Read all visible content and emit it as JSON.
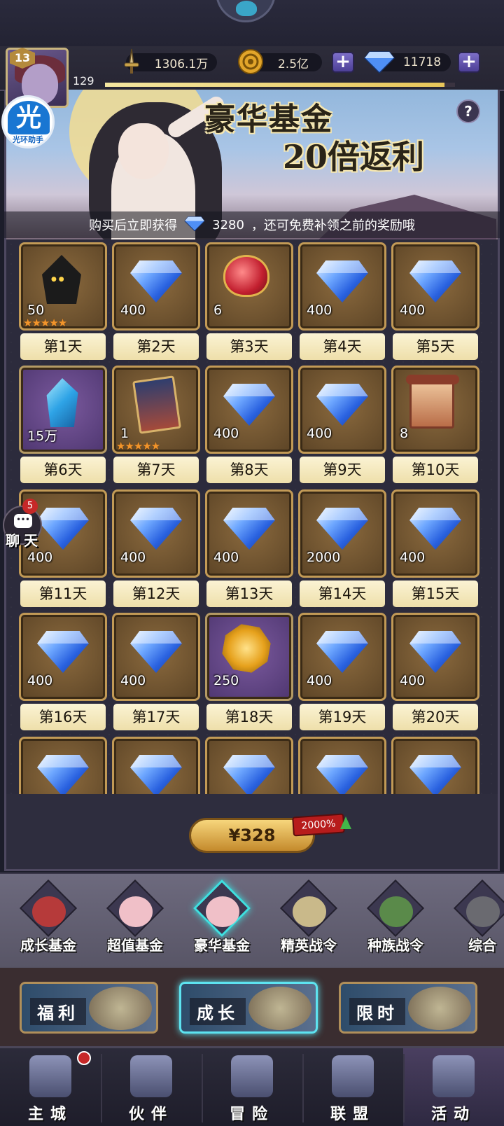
{
  "resources": {
    "power": "1306.1万",
    "gold": "2.5亿",
    "diamonds": "11718"
  },
  "player": {
    "level": "13",
    "exp_value": "129",
    "exp_progress": 0.97,
    "helper_glyph": "光",
    "helper_label": "光环助手"
  },
  "banner": {
    "title_line1": "豪华基金",
    "title_line2": "20倍返利",
    "help_glyph": "?",
    "note_prefix": "购买后立即获得",
    "note_amount": "3280",
    "note_suffix": "，还可免费补领之前的奖励哦"
  },
  "rewards": [
    {
      "day": "第1天",
      "qty": "50",
      "icon": "hooded-hero-icon",
      "stars": "★★★★★",
      "bg": "brown"
    },
    {
      "day": "第2天",
      "qty": "400",
      "icon": "diamond-icon",
      "stars": "",
      "bg": "brown"
    },
    {
      "day": "第3天",
      "qty": "6",
      "icon": "ruby-heart-icon",
      "stars": "",
      "bg": "brown"
    },
    {
      "day": "第4天",
      "qty": "400",
      "icon": "diamond-icon",
      "stars": "",
      "bg": "brown"
    },
    {
      "day": "第5天",
      "qty": "400",
      "icon": "diamond-icon",
      "stars": "",
      "bg": "brown"
    },
    {
      "day": "第6天",
      "qty": "15万",
      "icon": "crystal-icon",
      "stars": "",
      "bg": "purple"
    },
    {
      "day": "第7天",
      "qty": "1",
      "icon": "hero-card-icon",
      "stars": "★★★★★",
      "bg": "brown"
    },
    {
      "day": "第8天",
      "qty": "400",
      "icon": "diamond-icon",
      "stars": "",
      "bg": "brown"
    },
    {
      "day": "第9天",
      "qty": "400",
      "icon": "diamond-icon",
      "stars": "",
      "bg": "brown"
    },
    {
      "day": "第10天",
      "qty": "8",
      "icon": "scroll-icon",
      "stars": "",
      "bg": "brown"
    },
    {
      "day": "第11天",
      "qty": "400",
      "icon": "diamond-icon",
      "stars": "",
      "bg": "brown"
    },
    {
      "day": "第12天",
      "qty": "400",
      "icon": "diamond-icon",
      "stars": "",
      "bg": "brown"
    },
    {
      "day": "第13天",
      "qty": "400",
      "icon": "diamond-icon",
      "stars": "",
      "bg": "brown"
    },
    {
      "day": "第14天",
      "qty": "2000",
      "icon": "diamond-icon",
      "stars": "",
      "bg": "brown"
    },
    {
      "day": "第15天",
      "qty": "400",
      "icon": "diamond-icon",
      "stars": "",
      "bg": "brown"
    },
    {
      "day": "第16天",
      "qty": "400",
      "icon": "diamond-icon",
      "stars": "",
      "bg": "brown"
    },
    {
      "day": "第17天",
      "qty": "400",
      "icon": "diamond-icon",
      "stars": "",
      "bg": "brown"
    },
    {
      "day": "第18天",
      "qty": "250",
      "icon": "gold-token-icon",
      "stars": "",
      "bg": "purple"
    },
    {
      "day": "第19天",
      "qty": "400",
      "icon": "diamond-icon",
      "stars": "",
      "bg": "brown"
    },
    {
      "day": "第20天",
      "qty": "400",
      "icon": "diamond-icon",
      "stars": "",
      "bg": "brown"
    },
    {
      "day": "",
      "qty": "",
      "icon": "diamond-icon",
      "stars": "",
      "bg": "brown"
    },
    {
      "day": "",
      "qty": "",
      "icon": "diamond-icon",
      "stars": "",
      "bg": "brown"
    },
    {
      "day": "",
      "qty": "",
      "icon": "diamond-icon",
      "stars": "",
      "bg": "brown"
    },
    {
      "day": "",
      "qty": "",
      "icon": "diamond-icon",
      "stars": "",
      "bg": "brown"
    },
    {
      "day": "",
      "qty": "",
      "icon": "diamond-icon",
      "stars": "",
      "bg": "brown"
    }
  ],
  "chat": {
    "label": "聊天",
    "badge": "5"
  },
  "purchase": {
    "price": "¥328",
    "bonus": "2000%"
  },
  "fund_tabs": [
    {
      "label": "成长基金",
      "icon": "gift-chart-icon",
      "active": false
    },
    {
      "label": "超值基金",
      "icon": "piggy-bank-icon",
      "active": false
    },
    {
      "label": "豪华基金",
      "icon": "piggy-diamond-icon",
      "active": true
    },
    {
      "label": "精英战令",
      "icon": "scroll-badge-icon",
      "active": false
    },
    {
      "label": "种族战令",
      "icon": "vine-badge-icon",
      "active": false
    },
    {
      "label": "综合",
      "icon": "misc-badge-icon",
      "active": false
    }
  ],
  "categories": [
    {
      "label": "福利",
      "active": false
    },
    {
      "label": "成长",
      "active": true
    },
    {
      "label": "限时",
      "active": false
    }
  ],
  "nav": [
    {
      "label": "主城",
      "icon": "castle-icon",
      "dot": true
    },
    {
      "label": "伙伴",
      "icon": "witch-hat-icon",
      "dot": false
    },
    {
      "label": "冒险",
      "icon": "compass-icon",
      "dot": false
    },
    {
      "label": "联盟",
      "icon": "shield-icon",
      "dot": false
    },
    {
      "label": "活动",
      "icon": "cards-icon",
      "dot": false,
      "active": true
    }
  ],
  "colors": {
    "accent_gold": "#e8c65a",
    "active_cyan": "#3fe0e0",
    "badge_red": "#c62828",
    "diamond_blue": "#2a62e0"
  }
}
